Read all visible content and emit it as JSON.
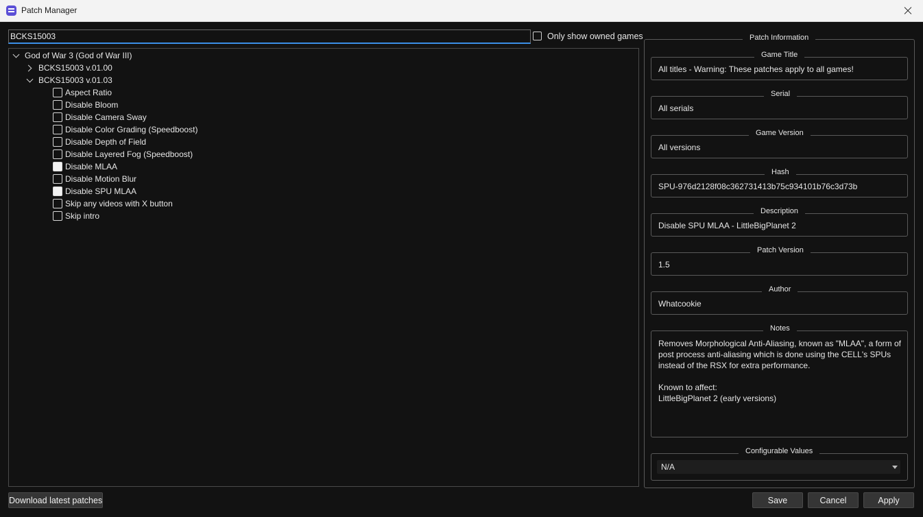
{
  "window": {
    "title": "Patch Manager",
    "app_icon": "rpcs3-icon",
    "close_icon": "close-icon"
  },
  "search": {
    "value": "BCKS15003",
    "owned_label": "Only show owned games",
    "owned_checked": false
  },
  "tree": {
    "game": "God of War 3 (God of War III)",
    "versions": [
      {
        "label": "BCKS15003 v.01.00",
        "expanded": false
      },
      {
        "label": "BCKS15003 v.01.03",
        "expanded": true
      }
    ],
    "patches": [
      {
        "label": "Aspect Ratio",
        "checked": false
      },
      {
        "label": "Disable Bloom",
        "checked": false
      },
      {
        "label": "Disable Camera Sway",
        "checked": false
      },
      {
        "label": "Disable Color Grading (Speedboost)",
        "checked": false
      },
      {
        "label": "Disable Depth of Field",
        "checked": false
      },
      {
        "label": "Disable Layered Fog (Speedboost)",
        "checked": false
      },
      {
        "label": "Disable MLAA",
        "checked": true
      },
      {
        "label": "Disable Motion Blur",
        "checked": false
      },
      {
        "label": "Disable SPU MLAA",
        "checked": true
      },
      {
        "label": "Skip any videos with X button",
        "checked": false
      },
      {
        "label": "Skip intro",
        "checked": false
      }
    ]
  },
  "info": {
    "group_title": "Patch Information",
    "game_title": {
      "label": "Game Title",
      "value": "All titles - Warning: These patches apply to all games!"
    },
    "serial": {
      "label": "Serial",
      "value": "All serials"
    },
    "game_version": {
      "label": "Game Version",
      "value": "All versions"
    },
    "hash": {
      "label": "Hash",
      "value": "SPU-976d2128f08c362731413b75c934101b76c3d73b"
    },
    "description": {
      "label": "Description",
      "value": "Disable SPU MLAA - LittleBigPlanet 2"
    },
    "patch_version": {
      "label": "Patch Version",
      "value": "1.5"
    },
    "author": {
      "label": "Author",
      "value": "Whatcookie"
    },
    "notes": {
      "label": "Notes",
      "value": "Removes Morphological Anti-Aliasing, known as \"MLAA\", a form of post process anti-aliasing which is done using the CELL's SPUs instead of the RSX for extra performance.\n\nKnown to affect:\nLittleBigPlanet 2 (early versions)"
    },
    "configurable": {
      "label": "Configurable Values",
      "value": "N/A"
    }
  },
  "buttons": {
    "download": "Download latest patches",
    "save": "Save",
    "cancel": "Cancel",
    "apply": "Apply"
  },
  "colors": {
    "background": "#121212",
    "titlebar": "#f3f3f3",
    "accent": "#3b8fe8",
    "button": "#353535"
  }
}
